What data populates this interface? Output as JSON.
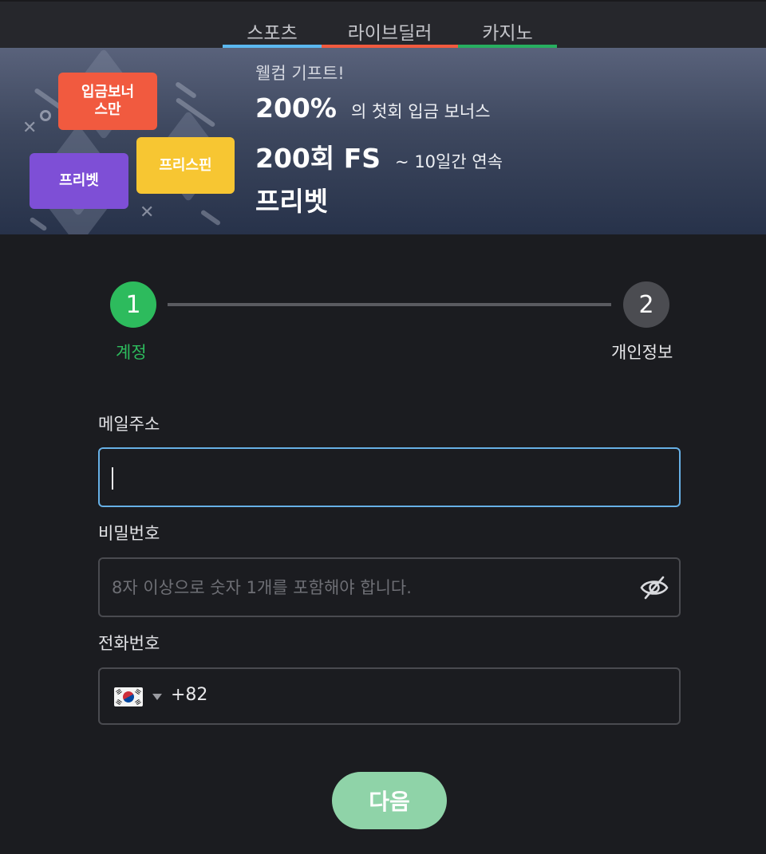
{
  "tabs": [
    {
      "label": "스포츠",
      "color": "#5bb8f0"
    },
    {
      "label": "라이브딜러",
      "color": "#f15a3f"
    },
    {
      "label": "카지노",
      "color": "#27ae60"
    }
  ],
  "banner": {
    "cards": {
      "deposit_bonus": "입금보너\n스만",
      "freebet": "프리벳",
      "freespin": "프리스핀"
    },
    "welcome": "웰컴 기프트!",
    "row1_big": "200%",
    "row1_small": "의 첫회 입금 보너스",
    "row2_big": "200회 FS",
    "row2_small": "~ 10일간 연속",
    "row3_big": "프리벳"
  },
  "stepper": {
    "step1_number": "1",
    "step1_label": "계정",
    "step2_number": "2",
    "step2_label": "개인정보"
  },
  "form": {
    "email_label": "메일주소",
    "email_value": "",
    "password_label": "비밀번호",
    "password_placeholder": "8자 이상으로 숫자 1개를 포함해야 합니다.",
    "phone_label": "전화번호",
    "phone_dial_code": "+82",
    "phone_country_flag": "korea-flag-icon"
  },
  "next_button": "다음"
}
